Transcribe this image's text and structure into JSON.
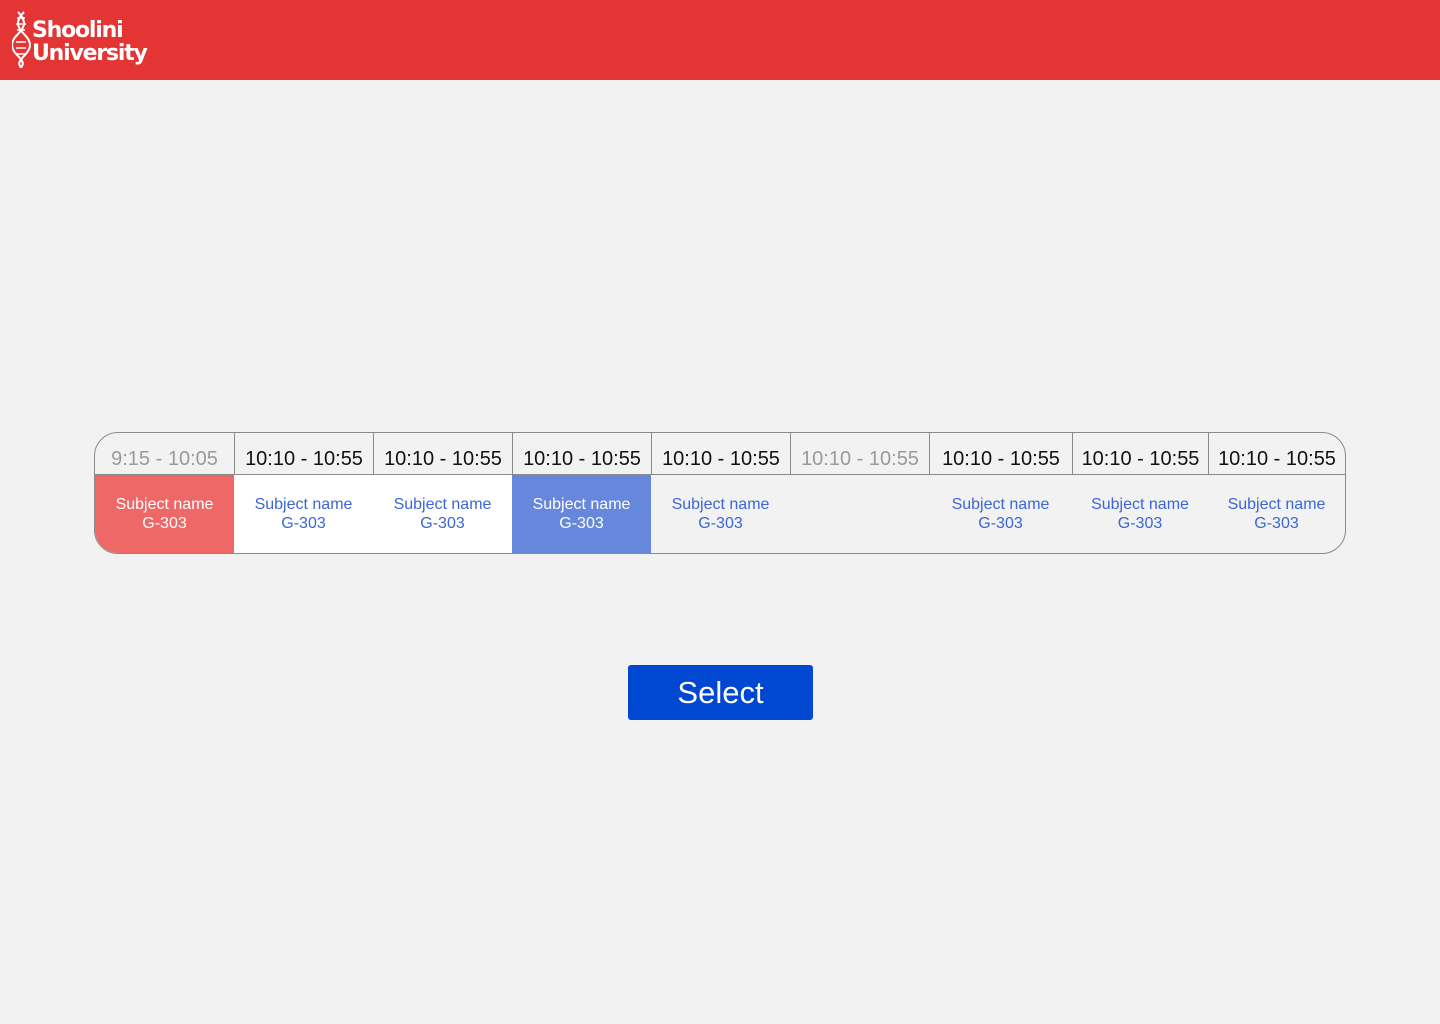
{
  "header": {
    "logo_line1": "Shoolini",
    "logo_line2": "University",
    "background_color": "#e43535"
  },
  "timetable": {
    "slots": [
      {
        "time": "9:15 - 10:05",
        "time_muted": true,
        "subject": "Subject name",
        "room": "G-303",
        "state": "past"
      },
      {
        "time": "10:10 - 10:55",
        "time_muted": false,
        "subject": "Subject name",
        "room": "G-303",
        "state": "available-light"
      },
      {
        "time": "10:10 - 10:55",
        "time_muted": false,
        "subject": "Subject name",
        "room": "G-303",
        "state": "available-light"
      },
      {
        "time": "10:10 - 10:55",
        "time_muted": false,
        "subject": "Subject name",
        "room": "G-303",
        "state": "selected"
      },
      {
        "time": "10:10 - 10:55",
        "time_muted": false,
        "subject": "Subject name",
        "room": "G-303",
        "state": "available"
      },
      {
        "time": "10:10 - 10:55",
        "time_muted": true,
        "subject": "",
        "room": "",
        "state": "empty"
      },
      {
        "time": "10:10 - 10:55",
        "time_muted": false,
        "subject": "Subject name",
        "room": "G-303",
        "state": "available"
      },
      {
        "time": "10:10 - 10:55",
        "time_muted": false,
        "subject": "Subject name",
        "room": "G-303",
        "state": "available"
      },
      {
        "time": "10:10 - 10:55",
        "time_muted": false,
        "subject": "Subject name",
        "room": "G-303",
        "state": "available"
      }
    ],
    "colors": {
      "past": "#ef6868",
      "selected": "#6687dc",
      "subject_text": "#3a66d8"
    }
  },
  "actions": {
    "select_label": "Select",
    "select_color": "#0047d1"
  }
}
